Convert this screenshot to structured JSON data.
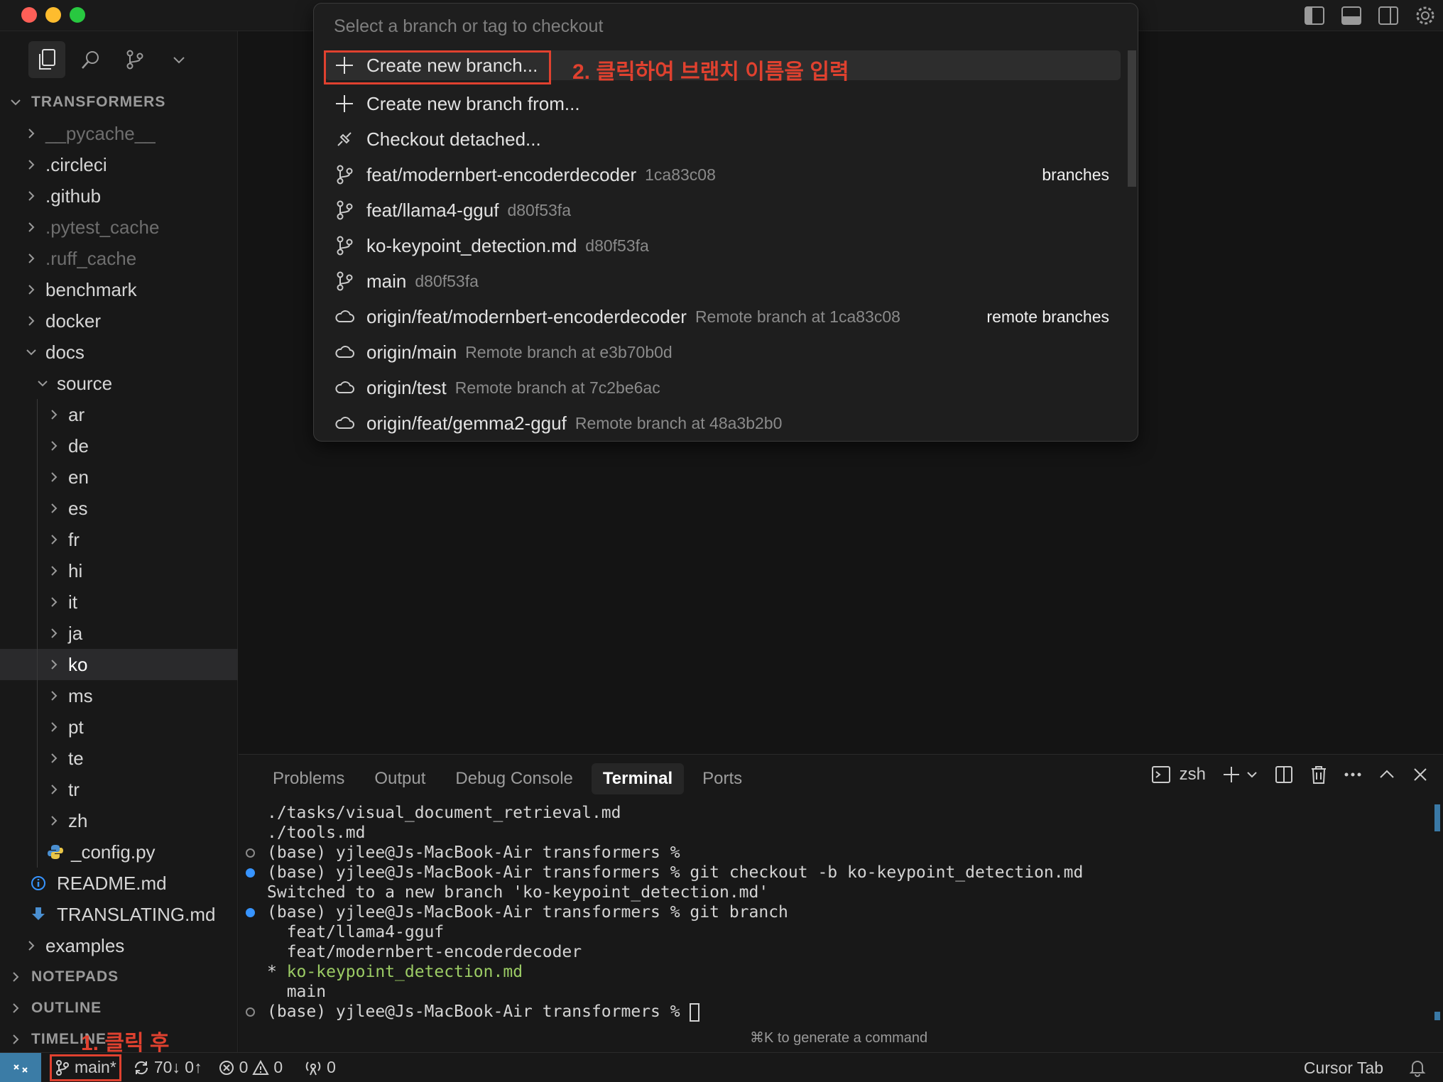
{
  "window": {
    "title_actions": [
      "toggle-primary-sidebar-icon",
      "toggle-panel-icon",
      "toggle-secondary-sidebar-icon",
      "gear-icon"
    ]
  },
  "sidebar": {
    "tools": [
      "files-icon",
      "search-icon",
      "source-control-icon",
      "chevron-down-icon"
    ],
    "section_title": "TRANSFORMERS",
    "tree": [
      {
        "label": "__pycache__",
        "depth": 1,
        "dim": true,
        "kind": "folder"
      },
      {
        "label": ".circleci",
        "depth": 1,
        "dim": false,
        "kind": "folder"
      },
      {
        "label": ".github",
        "depth": 1,
        "dim": false,
        "kind": "folder"
      },
      {
        "label": ".pytest_cache",
        "depth": 1,
        "dim": true,
        "kind": "folder"
      },
      {
        "label": ".ruff_cache",
        "depth": 1,
        "dim": true,
        "kind": "folder"
      },
      {
        "label": "benchmark",
        "depth": 1,
        "dim": false,
        "kind": "folder"
      },
      {
        "label": "docker",
        "depth": 1,
        "dim": false,
        "kind": "folder"
      },
      {
        "label": "docs",
        "depth": 1,
        "dim": false,
        "kind": "folder-open"
      },
      {
        "label": "source",
        "depth": 2,
        "dim": false,
        "kind": "folder-open"
      },
      {
        "label": "ar",
        "depth": 3,
        "dim": false,
        "kind": "folder"
      },
      {
        "label": "de",
        "depth": 3,
        "dim": false,
        "kind": "folder"
      },
      {
        "label": "en",
        "depth": 3,
        "dim": false,
        "kind": "folder"
      },
      {
        "label": "es",
        "depth": 3,
        "dim": false,
        "kind": "folder"
      },
      {
        "label": "fr",
        "depth": 3,
        "dim": false,
        "kind": "folder"
      },
      {
        "label": "hi",
        "depth": 3,
        "dim": false,
        "kind": "folder"
      },
      {
        "label": "it",
        "depth": 3,
        "dim": false,
        "kind": "folder"
      },
      {
        "label": "ja",
        "depth": 3,
        "dim": false,
        "kind": "folder"
      },
      {
        "label": "ko",
        "depth": 3,
        "dim": false,
        "kind": "folder",
        "selected": true
      },
      {
        "label": "ms",
        "depth": 3,
        "dim": false,
        "kind": "folder"
      },
      {
        "label": "pt",
        "depth": 3,
        "dim": false,
        "kind": "folder"
      },
      {
        "label": "te",
        "depth": 3,
        "dim": false,
        "kind": "folder"
      },
      {
        "label": "tr",
        "depth": 3,
        "dim": false,
        "kind": "folder"
      },
      {
        "label": "zh",
        "depth": 3,
        "dim": false,
        "kind": "folder"
      },
      {
        "label": "_config.py",
        "depth": 3,
        "dim": false,
        "kind": "python-file"
      },
      {
        "label": "README.md",
        "depth": 2,
        "dim": false,
        "kind": "info-file"
      },
      {
        "label": "TRANSLATING.md",
        "depth": 2,
        "dim": false,
        "kind": "download-file"
      },
      {
        "label": "examples",
        "depth": 1,
        "dim": false,
        "kind": "folder"
      }
    ],
    "sections": [
      "NOTEPADS",
      "OUTLINE",
      "TIMELINE"
    ]
  },
  "quickpick": {
    "placeholder": "Select a branch or tag to checkout",
    "items": [
      {
        "icon": "plus",
        "label": "Create new branch...",
        "desc": "",
        "group": ""
      },
      {
        "icon": "plus",
        "label": "Create new branch from...",
        "desc": "",
        "group": ""
      },
      {
        "icon": "detach",
        "label": "Checkout detached...",
        "desc": "",
        "group": ""
      },
      {
        "icon": "branch",
        "label": "feat/modernbert-encoderdecoder",
        "desc": "1ca83c08",
        "group": "branches"
      },
      {
        "icon": "branch",
        "label": "feat/llama4-gguf",
        "desc": "d80f53fa",
        "group": ""
      },
      {
        "icon": "branch",
        "label": "ko-keypoint_detection.md",
        "desc": "d80f53fa",
        "group": ""
      },
      {
        "icon": "branch",
        "label": "main",
        "desc": "d80f53fa",
        "group": ""
      },
      {
        "icon": "cloud",
        "label": "origin/feat/modernbert-encoderdecoder",
        "desc": "Remote branch at 1ca83c08",
        "group": "remote branches"
      },
      {
        "icon": "cloud",
        "label": "origin/main",
        "desc": "Remote branch at e3b70b0d",
        "group": ""
      },
      {
        "icon": "cloud",
        "label": "origin/test",
        "desc": "Remote branch at 7c2be6ac",
        "group": ""
      },
      {
        "icon": "cloud",
        "label": "origin/feat/gemma2-gguf",
        "desc": "Remote branch at 48a3b2b0",
        "group": ""
      }
    ]
  },
  "annotations": {
    "step2": "2. 클릭하여 브랜치 이름을 입력",
    "step1": "1. 클릭 후",
    "color": "#e0412f"
  },
  "panel": {
    "tabs": [
      "Problems",
      "Output",
      "Debug Console",
      "Terminal",
      "Ports"
    ],
    "active_tab": "Terminal",
    "shell": "zsh",
    "terminal_lines": [
      {
        "marker": "",
        "text": "./tasks/visual_document_retrieval.md"
      },
      {
        "marker": "",
        "text": "./tools.md"
      },
      {
        "marker": "hollow",
        "text": "(base) yjlee@Js-MacBook-Air transformers %"
      },
      {
        "marker": "filled",
        "text": "(base) yjlee@Js-MacBook-Air transformers % git checkout -b ko-keypoint_detection.md"
      },
      {
        "marker": "",
        "text": "Switched to a new branch 'ko-keypoint_detection.md'"
      },
      {
        "marker": "filled",
        "text": "(base) yjlee@Js-MacBook-Air transformers % git branch"
      },
      {
        "marker": "",
        "text": "  feat/llama4-gguf"
      },
      {
        "marker": "",
        "text": "  feat/modernbert-encoderdecoder"
      },
      {
        "marker": "",
        "prefix": "* ",
        "text": "ko-keypoint_detection.md",
        "green": true
      },
      {
        "marker": "",
        "text": "  main"
      },
      {
        "marker": "hollow",
        "text": "(base) yjlee@Js-MacBook-Air transformers % ",
        "cursor": true
      }
    ],
    "hint": "⌘K to generate a command"
  },
  "statusbar": {
    "branch": "main*",
    "sync": "70↓ 0↑",
    "errors": "0",
    "warnings": "0",
    "ports": "0",
    "right_label": "Cursor Tab",
    "remote_color": "#3b7ca6"
  }
}
